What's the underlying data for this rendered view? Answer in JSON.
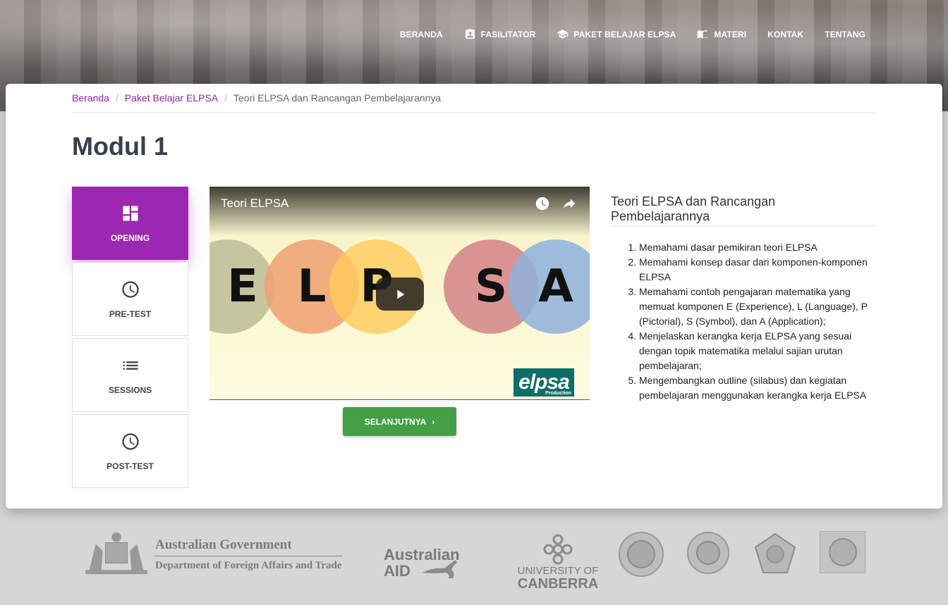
{
  "nav": {
    "items": [
      {
        "label": "BERANDA",
        "icon": ""
      },
      {
        "label": "FASILITATOR",
        "icon": "badge-icon"
      },
      {
        "label": "PAKET BELAJAR ELPSA",
        "icon": "school-icon"
      },
      {
        "label": "MATERI",
        "icon": "book-icon"
      },
      {
        "label": "KONTAK",
        "icon": ""
      },
      {
        "label": "TENTANG",
        "icon": ""
      }
    ]
  },
  "breadcrumb": {
    "items": [
      "Beranda",
      "Paket Belajar ELPSA"
    ],
    "current": "Teori ELPSA dan Rancangan Pembelajarannya"
  },
  "page": {
    "title": "Modul 1"
  },
  "side_menu": [
    {
      "label": "OPENING",
      "icon": "dashboard-icon",
      "active": true
    },
    {
      "label": "PRE-TEST",
      "icon": "clock-icon",
      "active": false
    },
    {
      "label": "SESSIONS",
      "icon": "list-icon",
      "active": false
    },
    {
      "label": "POST-TEST",
      "icon": "clock-icon",
      "active": false
    }
  ],
  "video": {
    "title": "Teori ELPSA",
    "letters": [
      "E",
      "L",
      "P",
      "S",
      "A"
    ],
    "logo_text": "elpsa",
    "logo_subtext": "Production"
  },
  "next_button": {
    "label": "SELANJUTNYA"
  },
  "info": {
    "title": "Teori ELPSA dan Rancangan Pembelajarannya",
    "objectives": [
      "Memahami dasar pemikiran teori ELPSA",
      "Memahami konsep dasar dari komponen-komponen ELPSA",
      "Memahami contoh pengajaran matematika yang memuat komponen E (Experience), L (Language), P (Pictorial), S (Symbol), dan A (Application);",
      "Menjelaskan kerangka kerja ELPSA yang sesuai dengan topik matematika melalui sajian urutan pembelajaran;",
      "Mengembangkan outline (silabus) dan kegiatan pembelajaran menggunakan kerangka kerja ELPSA"
    ]
  },
  "footer": {
    "ag_line1": "Australian Government",
    "ag_line2": "Department of Foreign Affairs and Trade",
    "aid_line1": "Australian",
    "aid_line2": "AID",
    "uc_line1": "UNIVERSITY OF",
    "uc_line2": "CANBERRA"
  },
  "colors": {
    "accent": "#9c27b0",
    "link": "#8e24aa",
    "button": "#43a047"
  }
}
